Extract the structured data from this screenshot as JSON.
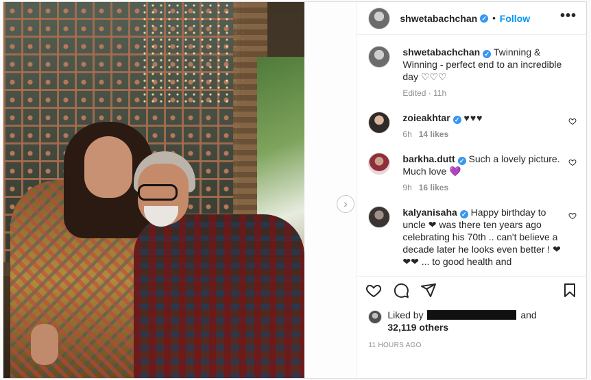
{
  "post": {
    "owner": "shwetabachchan",
    "follow_label": "Follow",
    "more_label": "•••",
    "separator": "•"
  },
  "caption": {
    "username": "shwetabachchan",
    "text": "Twinning & Winning - perfect end to an incredible day ♡♡♡",
    "meta": "Edited · 11h"
  },
  "comments": [
    {
      "username": "zoieakhtar",
      "verified": true,
      "text": "♥♥♥",
      "time": "6h",
      "likes": "14 likes"
    },
    {
      "username": "barkha.dutt",
      "verified": true,
      "text": "Such a lovely picture. Much love 💜",
      "time": "9h",
      "likes": "16 likes"
    },
    {
      "username": "kalyanisaha",
      "verified": true,
      "text": "Happy birthday to uncle ❤ was there ten years ago celebrating his 70th .. can't believe a decade later he looks even better ! ❤❤❤ ... to good health and"
    }
  ],
  "likes": {
    "prefix": "Liked by",
    "suffix": "and",
    "count": "32,119 others"
  },
  "timestamp": "11 HOURS AGO",
  "icons": {
    "verified": "✓",
    "next": "›"
  }
}
